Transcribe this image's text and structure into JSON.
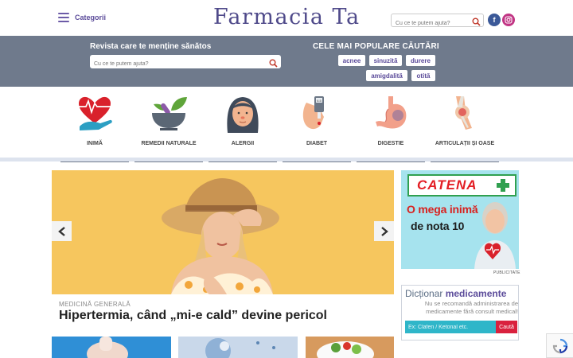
{
  "header": {
    "menu_label": "Categorii",
    "logo": "Farmacia Ta",
    "search_placeholder": "Cu ce te putem ajuta?",
    "social": [
      "facebook-icon",
      "instagram-icon"
    ]
  },
  "band": {
    "title": "Revista care te menține sănătos",
    "search_placeholder": "Cu ce te putem ajuta?",
    "popular_title": "CELE MAI POPULARE CĂUTĂRI",
    "tags": [
      "acnee",
      "sinuzită",
      "durere",
      "amigdalită",
      "otită"
    ]
  },
  "categories": [
    {
      "label": "INIMĂ",
      "icon": "heart-hand-icon"
    },
    {
      "label": "REMEDII NATURALE",
      "icon": "mortar-leaf-icon"
    },
    {
      "label": "ALERGII",
      "icon": "woman-face-icon"
    },
    {
      "label": "DIABET",
      "icon": "glucose-meter-icon"
    },
    {
      "label": "DIGESTIE",
      "icon": "stomach-icon"
    },
    {
      "label": "ARTICULAȚII ȘI OASE",
      "icon": "knee-joint-icon"
    }
  ],
  "hero": {
    "category": "MEDICINĂ GENERALĂ",
    "title": "Hipertermia, când „mi-e cald” devine pericol"
  },
  "ad": {
    "brand": "CATENA",
    "line1": "O mega inimă",
    "line2": "de nota 10",
    "label": "PUBLICITATE"
  },
  "dictionary": {
    "title_light": "Dicționar",
    "title_bold": "medicamente",
    "note": "Nu se recomandă administrarea de medicamente fără consult medical!",
    "placeholder": "Ex: Clafen / Ketonal etc.",
    "button": "Caută"
  },
  "colors": {
    "brand_purple": "#5b4b9a",
    "band_gray": "#6f7a8c",
    "ad_red": "#d9211f",
    "dict_teal": "#2fb6c9"
  }
}
